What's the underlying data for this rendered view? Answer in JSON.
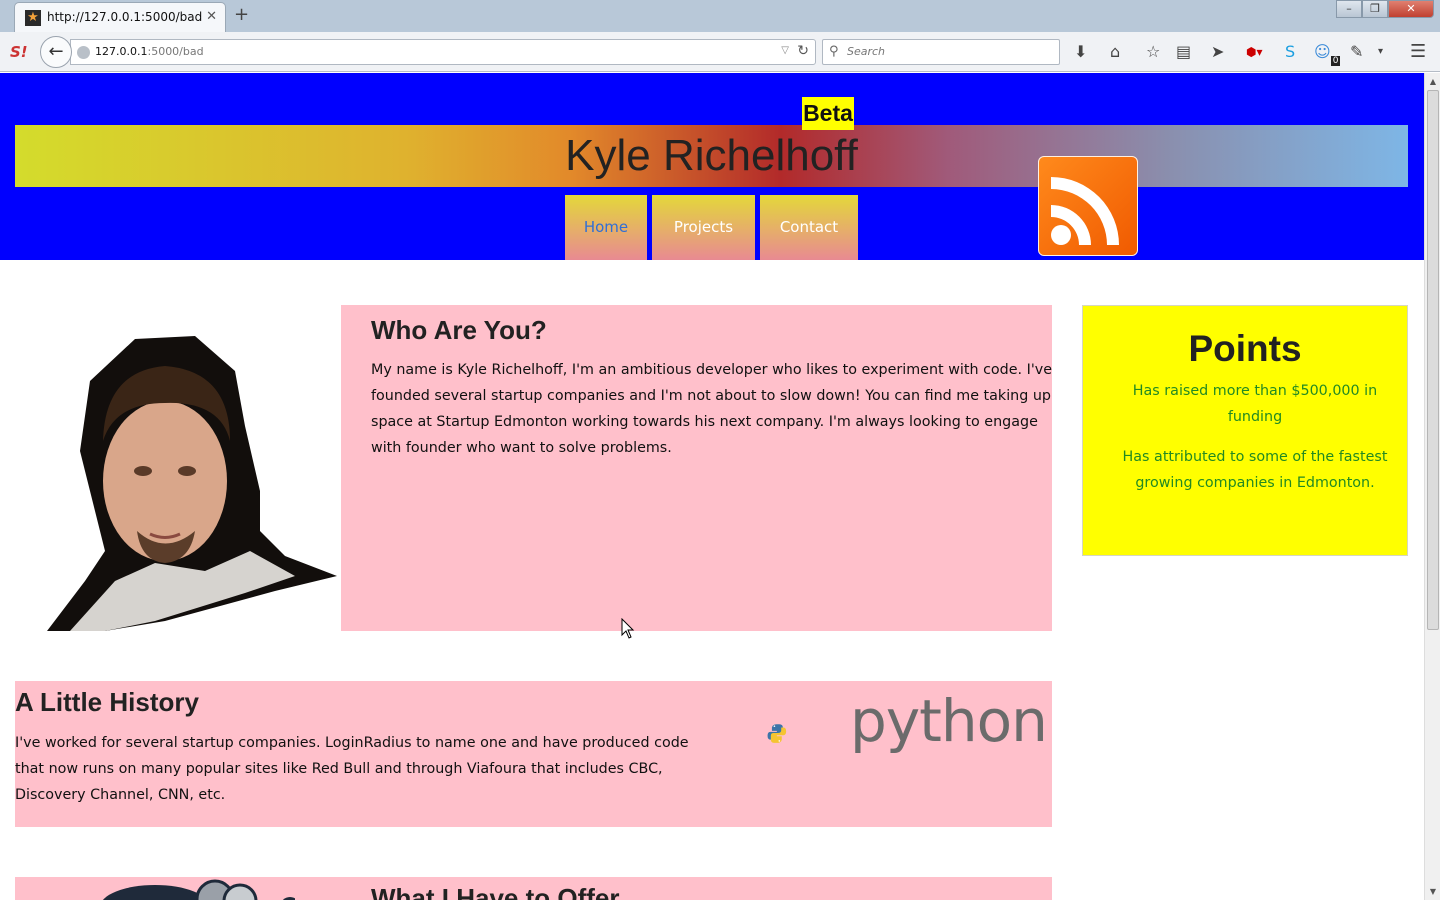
{
  "browser": {
    "tab_title": "http://127.0.0.1:5000/bad",
    "url_host": "127.0.0.1",
    "url_rest": ":5000/bad",
    "search_placeholder": "Search",
    "notification_count": "0"
  },
  "header": {
    "badge": "Beta",
    "title": "Kyle Richelhoff",
    "nav": [
      "Home",
      "Projects",
      "Contact"
    ],
    "active_nav": "Home"
  },
  "about": {
    "heading": "Who Are You?",
    "body": "My name is Kyle Richelhoff, I'm an ambitious developer who likes to experiment with code. I've founded several startup companies and I'm not about to slow down! You can find me taking up space at Startup Edmonton working towards his next company. I'm always looking to engage with founder who want to solve problems."
  },
  "points": {
    "heading": "Points",
    "items": [
      "Has raised more than $500,000 in funding",
      "Has attributed to some of the fastest growing companies in Edmonton."
    ]
  },
  "history": {
    "heading": "A Little History",
    "body": "I've worked for several startup companies. LoginRadius to name one and have produced code that now runs on many popular sites like Red Bull and through Viafoura that includes CBC, Discovery Channel, CNN, etc.",
    "logo_text": "python"
  },
  "offer": {
    "heading": "What I Have to Offer"
  },
  "colors": {
    "header_bg": "#0000ff",
    "card_pink": "#ffc0cb",
    "points_bg": "#ffff00",
    "points_text": "#228a22"
  }
}
